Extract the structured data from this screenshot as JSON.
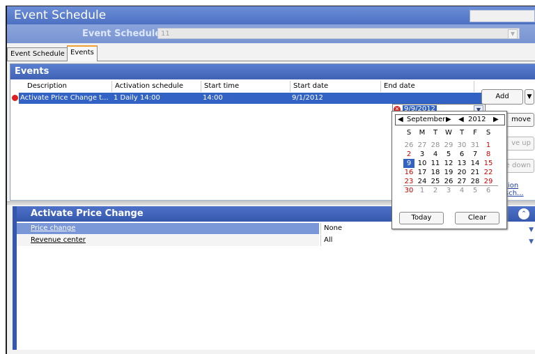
{
  "window": {
    "title": "Event Schedule"
  },
  "schedule_selector": {
    "label": "Event Schedule:",
    "value": "11"
  },
  "tabs": [
    {
      "label": "Event Schedule"
    },
    {
      "label": "Events",
      "active": true
    }
  ],
  "events_panel": {
    "title": "Events",
    "columns": [
      "Description",
      "Activation schedule",
      "Start time",
      "Start date",
      "End date"
    ],
    "rows": [
      {
        "description": "Activate Price Change t...",
        "activation_schedule": "1 Daily  14:00",
        "start_time": "14:00",
        "start_date": "9/1/2012",
        "end_date": "9/9/2012"
      }
    ],
    "buttons": {
      "add": "Add",
      "remove": "move",
      "move_up": "ve up",
      "move_down": "e down",
      "link": "tion sch..."
    }
  },
  "calendar": {
    "month": "September",
    "year": "2012",
    "weekdays": [
      "S",
      "M",
      "T",
      "W",
      "T",
      "F",
      "S"
    ],
    "weeks": [
      [
        "26",
        "27",
        "28",
        "29",
        "30",
        "31",
        "1"
      ],
      [
        "2",
        "3",
        "4",
        "5",
        "6",
        "7",
        "8"
      ],
      [
        "9",
        "10",
        "11",
        "12",
        "13",
        "14",
        "15"
      ],
      [
        "16",
        "17",
        "18",
        "19",
        "20",
        "21",
        "22"
      ],
      [
        "23",
        "24",
        "25",
        "26",
        "27",
        "28",
        "29"
      ],
      [
        "30",
        "1",
        "2",
        "3",
        "4",
        "5",
        "6"
      ]
    ],
    "selected_day": "9",
    "today_button": "Today",
    "clear_button": "Clear"
  },
  "properties": {
    "title": "Activate Price Change",
    "rows": [
      {
        "name": "Price change",
        "value": "None"
      },
      {
        "name": "Revenue center",
        "value": "All"
      }
    ]
  },
  "colors": {
    "selection": "#3263c4",
    "header": "#4e72c8",
    "weekend_red": "#cc0000"
  }
}
